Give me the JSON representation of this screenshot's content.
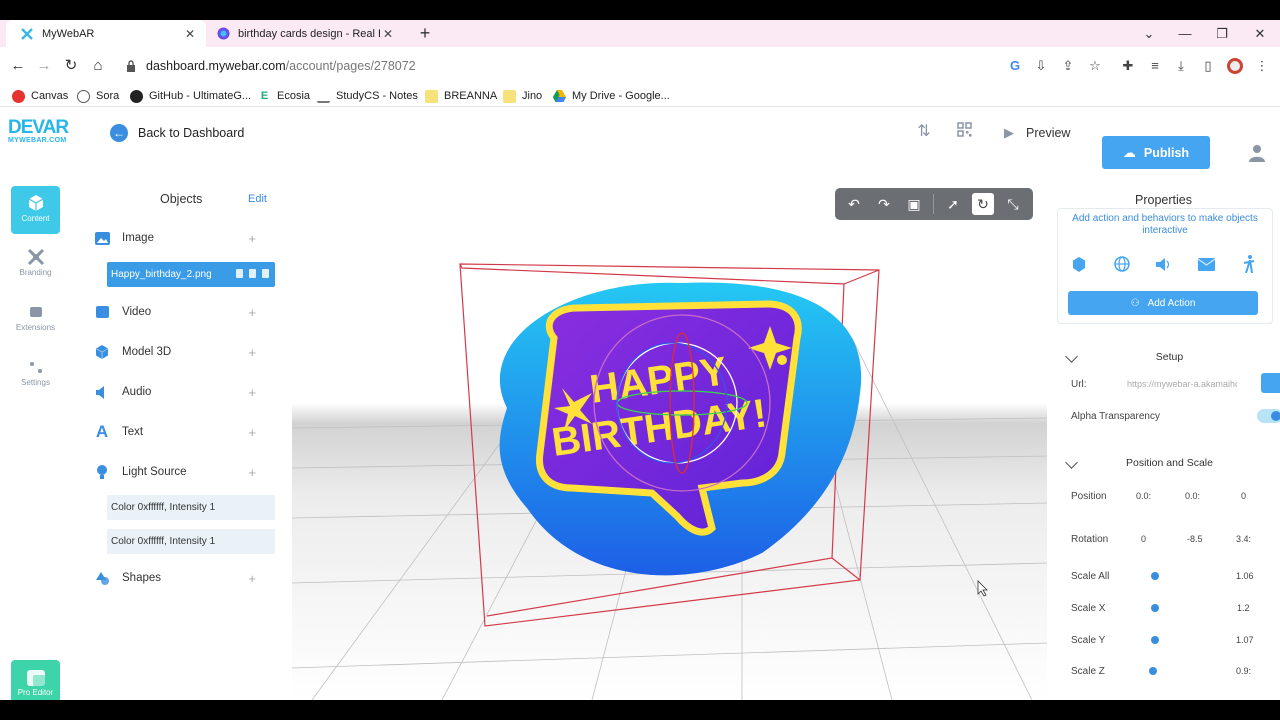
{
  "browser": {
    "tabs": [
      {
        "title": "MyWebAR",
        "active": true
      },
      {
        "title": "birthday cards design - Real Esta",
        "active": false
      }
    ],
    "url_domain": "dashboard.mywebar.com",
    "url_path": "/account/pages/278072",
    "bookmarks": [
      "Canvas",
      "Sora",
      "GitHub - UltimateG...",
      "Ecosia",
      "StudyCS - Notes",
      "BREANNA",
      "Jino",
      "My Drive - Google..."
    ]
  },
  "app": {
    "logo_top": "DEVAR",
    "logo_bottom": "MYWEBAR.COM",
    "back_label": "Back to Dashboard",
    "preview_label": "Preview",
    "publish_label": "Publish"
  },
  "rail": {
    "content": "Content",
    "branding": "Branding",
    "extensions": "Extensions",
    "settings": "Settings",
    "pro_editor": "Pro Editor"
  },
  "objects": {
    "title": "Objects",
    "edit": "Edit",
    "image": "Image",
    "image_item": "Happy_birthday_2.png",
    "video": "Video",
    "model3d": "Model 3D",
    "audio": "Audio",
    "text": "Text",
    "light": "Light Source",
    "light_item_1": "Color 0xffffff, Intensity 1",
    "light_item_2": "Color 0xffffff, Intensity 1",
    "shapes": "Shapes",
    "add": "+"
  },
  "scene": {
    "card_line1": "HAPPY",
    "card_line2": "BIRTHDAY!"
  },
  "properties": {
    "title": "Properties",
    "description": "Add action and behaviors to make objects interactive",
    "add_action": "Add Action",
    "setup": "Setup",
    "url_label": "Url:",
    "url_value": "https://mywebar-a.akamaihc",
    "alpha_label": "Alpha Transparency",
    "pos_scale": "Position and Scale",
    "position_label": "Position",
    "position": [
      "0.0:",
      "0.0:",
      "0"
    ],
    "rotation_label": "Rotation",
    "rotation": [
      "0",
      "-8.5",
      "3.4:"
    ],
    "scale_all_label": "Scale All",
    "scale_all": "1.06",
    "scale_x_label": "Scale X",
    "scale_x": "1.2",
    "scale_y_label": "Scale Y",
    "scale_y": "1.07",
    "scale_z_label": "Scale Z",
    "scale_z": "0.9:"
  }
}
